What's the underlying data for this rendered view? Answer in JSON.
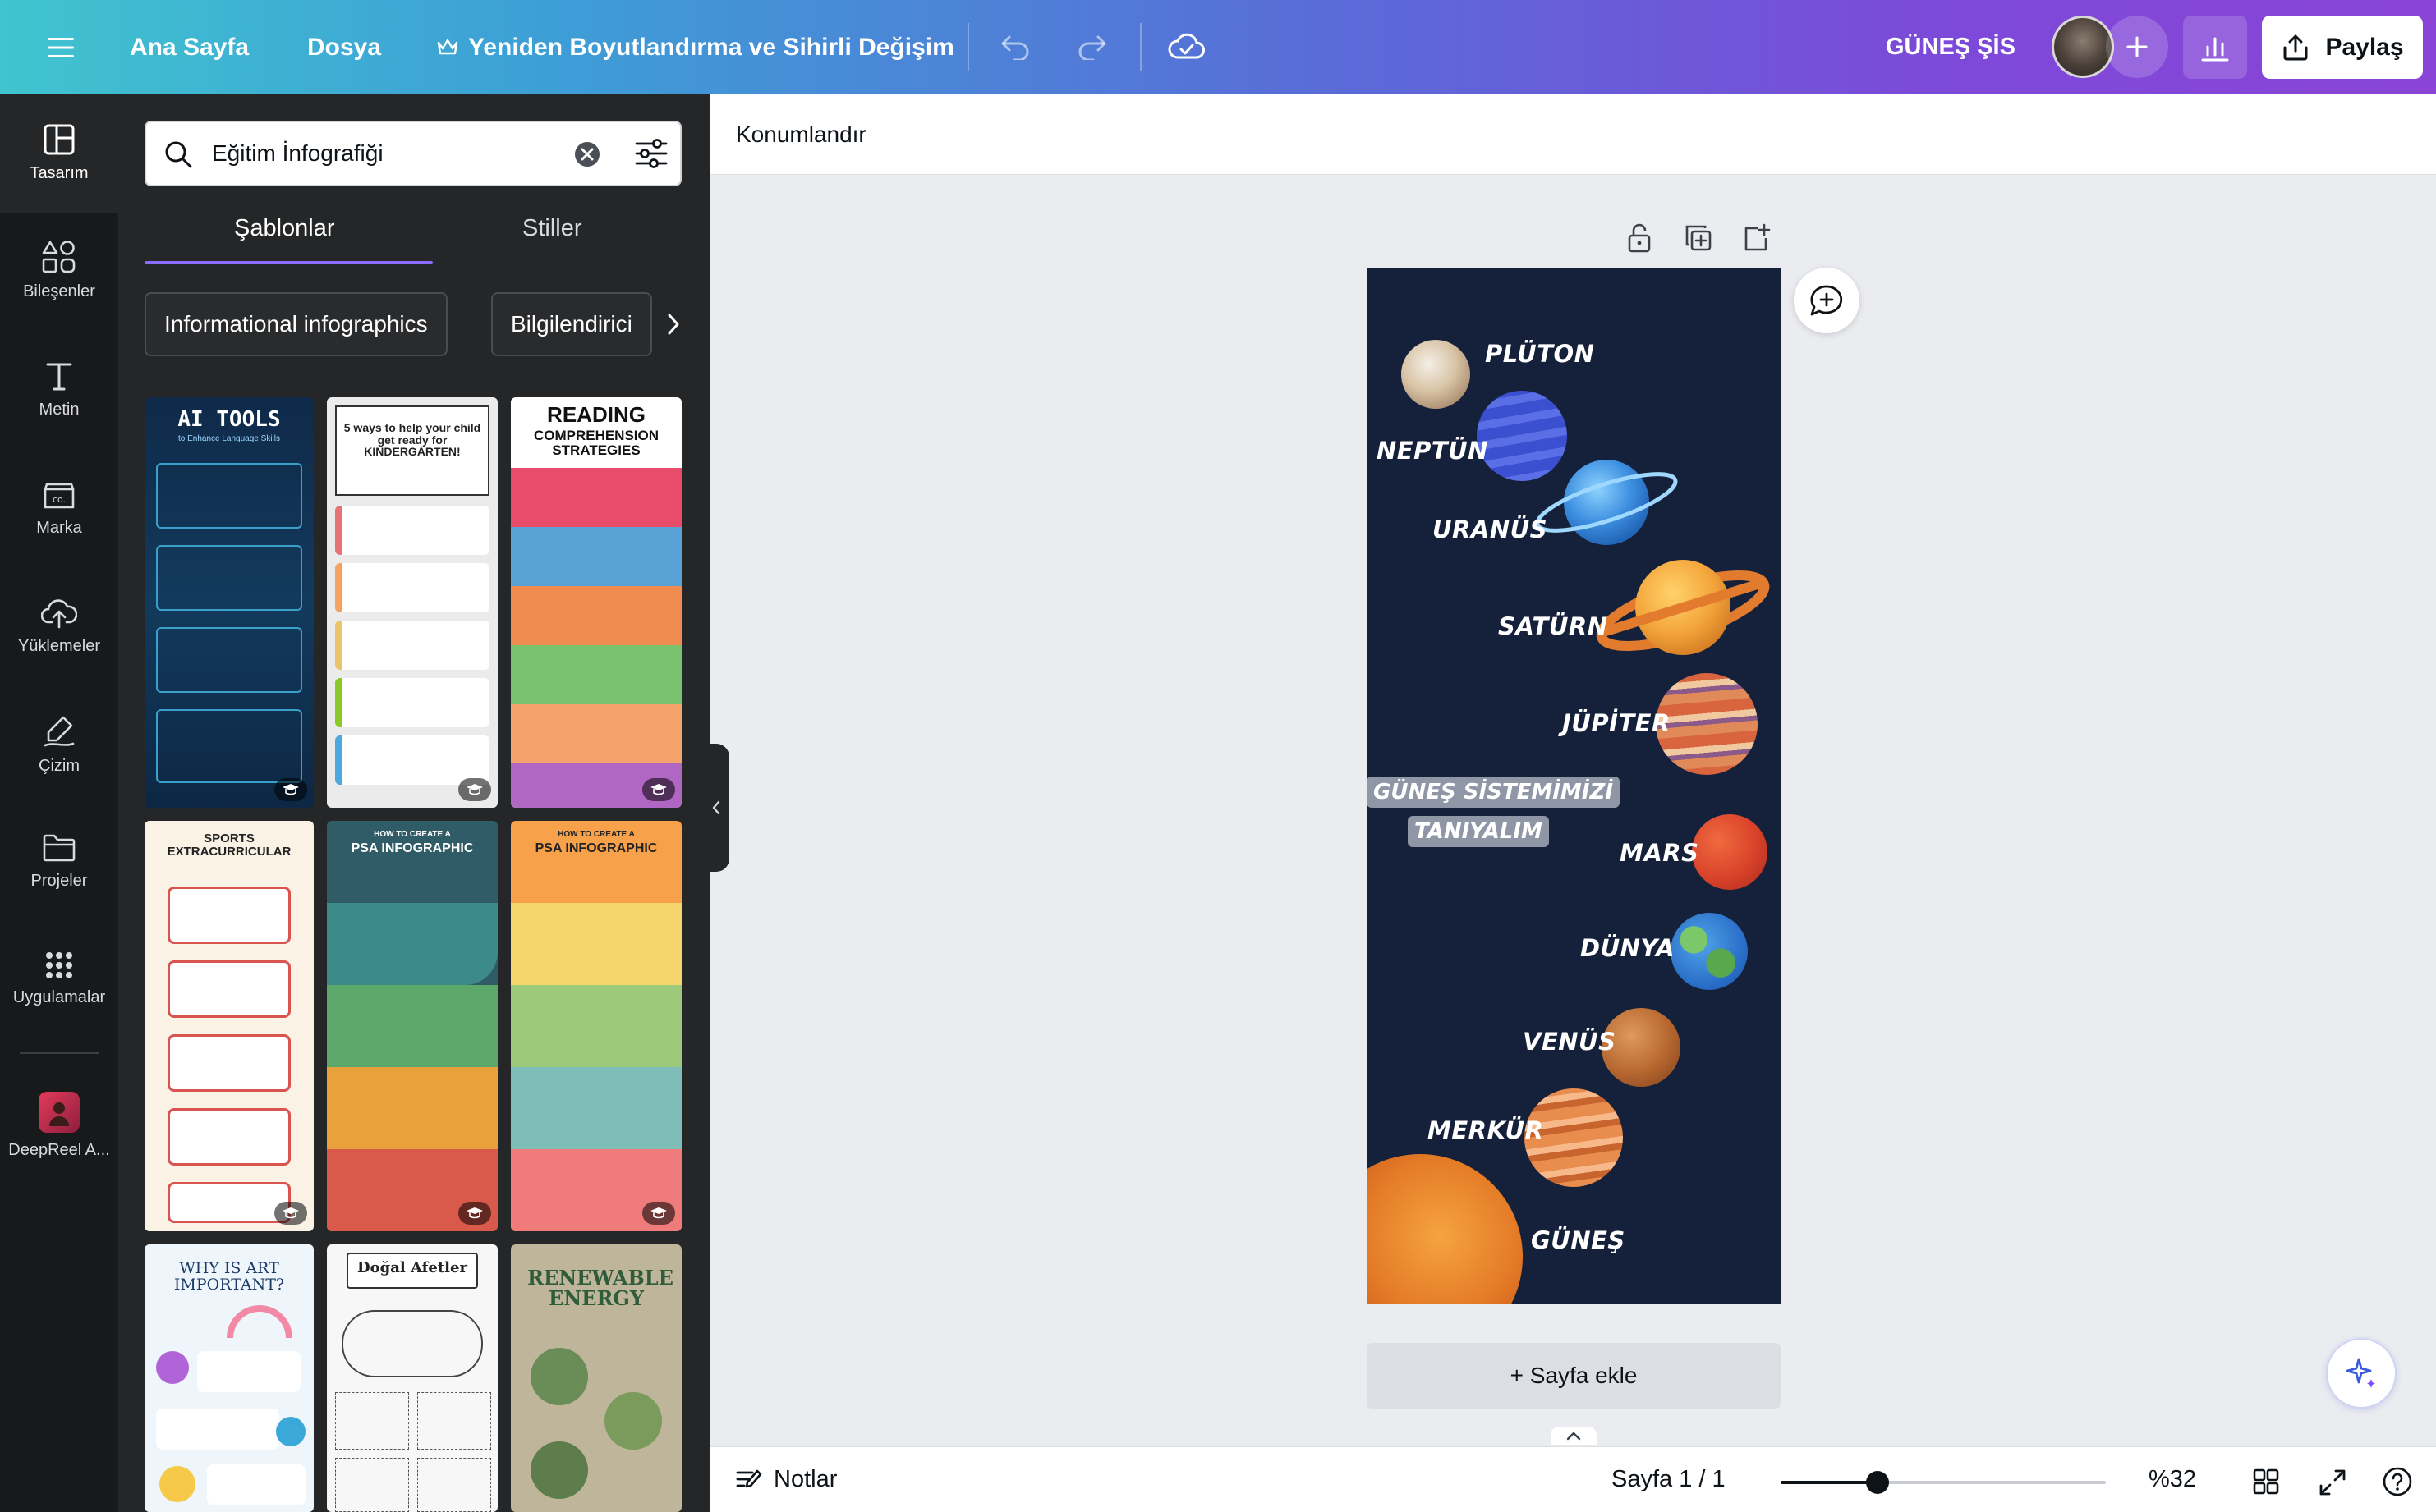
{
  "topbar": {
    "home": "Ana Sayfa",
    "file": "Dosya",
    "resize": "Yeniden Boyutlandırma ve Sihirli Değişim",
    "project_title": "GÜNEŞ ŞİS",
    "share": "Paylaş"
  },
  "rail": {
    "items": [
      {
        "label": "Tasarım",
        "icon": "layout-icon"
      },
      {
        "label": "Bileşenler",
        "icon": "shapes-icon"
      },
      {
        "label": "Metin",
        "icon": "text-icon"
      },
      {
        "label": "Marka",
        "icon": "brand-icon"
      },
      {
        "label": "Yüklemeler",
        "icon": "upload-cloud-icon"
      },
      {
        "label": "Çizim",
        "icon": "draw-icon"
      },
      {
        "label": "Projeler",
        "icon": "folder-icon"
      },
      {
        "label": "Uygulamalar",
        "icon": "apps-grid-icon"
      },
      {
        "label": "DeepReel A...",
        "icon": "deepreel-app-icon"
      }
    ]
  },
  "panel": {
    "search_value": "Eğitim İnfografiği",
    "tabs": [
      "Şablonlar",
      "Stiller"
    ],
    "chips": [
      "Informational infographics",
      "Bilgilendirici"
    ],
    "templates": [
      {
        "title": "AI TOOLS",
        "subtitle": "to Enhance Language Skills"
      },
      {
        "title": "5 ways to help your child get ready for KINDERGARTEN!",
        "subtitle": ""
      },
      {
        "title": "READING",
        "subtitle": "COMPREHENSION STRATEGIES"
      },
      {
        "title": "SPORTS EXTRACURRICULAR",
        "subtitle": ""
      },
      {
        "title": "PSA INFOGRAPHIC",
        "subtitle": "HOW TO CREATE A"
      },
      {
        "title": "PSA INFOGRAPHIC",
        "subtitle": "HOW TO CREATE A"
      },
      {
        "title": "WHY IS ART IMPORTANT?",
        "subtitle": ""
      },
      {
        "title": "Doğal Afetler",
        "subtitle": ""
      },
      {
        "title": "RENEWABLE ENERGY",
        "subtitle": ""
      }
    ]
  },
  "context_bar": {
    "label": "Konumlandır"
  },
  "design": {
    "title_line1": "GÜNEŞ SİSTEMİMİZİ",
    "title_line2": "TANIYALIM",
    "planets": [
      "PLÜTON",
      "NEPTÜN",
      "URANÜS",
      "SATÜRN",
      "JÜPİTER",
      "MARS",
      "DÜNYA",
      "VENÜS",
      "MERKÜR",
      "GÜNEŞ"
    ]
  },
  "add_page": "+ Sayfa ekle",
  "bottombar": {
    "notes": "Notlar",
    "page_indicator": "Sayfa 1 / 1",
    "zoom": "%32",
    "zoom_fraction": 0.32
  },
  "colors": {
    "accent": "#8b6cff",
    "design_bg": "#15213a",
    "panel_bg": "#252627",
    "rail_bg": "#18191b"
  }
}
